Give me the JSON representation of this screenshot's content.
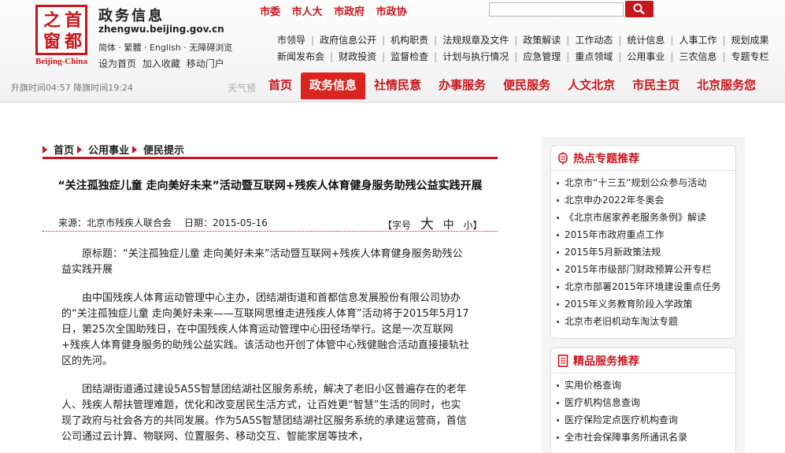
{
  "header": {
    "logo_chars": [
      "之",
      "首",
      "窗",
      "都"
    ],
    "logo_en": "Beijing-China",
    "site_title": "政务信息",
    "domain": "zhengwu.beijing.gov.cn",
    "lang_links": "简体 · 繁體 · English · 无障碍浏览",
    "util_links": [
      "设为首页",
      "加入收藏",
      "移动门户"
    ],
    "top_links": [
      "市委",
      "市人大",
      "市政府",
      "市政协"
    ],
    "search_placeholder": "",
    "sunrise_text": "升旗时间04:57 降旗时间19:24",
    "weather_text": "天气预"
  },
  "menu": {
    "row1": [
      "市领导",
      "政府信息公开",
      "机构职责",
      "法规规章及文件",
      "政策解读",
      "工作动态",
      "统计信息",
      "人事工作",
      "规划成果"
    ],
    "row2": [
      "新闻发布会",
      "财政投资",
      "监督检查",
      "计划与执行情况",
      "应急管理",
      "重点领域",
      "公用事业",
      "三农信息",
      "专题专栏"
    ]
  },
  "main_nav": [
    "首页",
    "政务信息",
    "社情民意",
    "办事服务",
    "便民服务",
    "人文北京",
    "市民主页",
    "北京服务您"
  ],
  "main_nav_active": 1,
  "breadcrumb": [
    "首页",
    "公用事业",
    "便民提示"
  ],
  "article": {
    "title": "“关注孤独症儿童 走向美好未来”活动暨互联网+残疾人体育健身服务助残公益实践开展",
    "source": "来源：北京市残疾人联合会",
    "date": "日期：2015-05-16",
    "font_label": "【字号",
    "font_large": "大",
    "font_medium": "中",
    "font_small": "小】",
    "paragraphs": [
      "原标题：“关注孤独症儿童 走向美好未来”活动暨互联网+残疾人体育健身服务助残公益实践开展",
      "由中国残疾人体育运动管理中心主办，团结湖街道和首都信息发展股份有限公司协办的“关注孤独症儿童 走向美好未来——互联网思维走进残疾人体育”活动将于2015年5月17日，第25次全国助残日，在中国残疾人体育运动管理中心田径场举行。这是一次互联网+残疾人体育健身服务的助残公益实践。该活动也开创了体管中心残健融合活动直接接轨社区的先河。",
      "团结湖街道通过建设5A5S智慧团结湖社区服务系统，解决了老旧小区普遍存在的老年人、残疾人帮扶管理难题，优化和改变居民生活方式，让百姓更“智慧”生活的同时，也实现了政府与社会各方的共同发展。作为5A5S智慧团结湖社区服务系统的承建运营商，首信公司通过云计算、物联网、位置服务、移动交互、智能家居等技术，"
    ]
  },
  "hot_topics": {
    "title": "热点专题推荐",
    "items": [
      "北京市“十三五”规划公众参与活动",
      "北京申办2022年冬奥会",
      "《北京市居家养老服务条例》解读",
      "2015年市政府重点工作",
      "2015年5月新政策法规",
      "2015年市级部门财政预算公开专栏",
      "北京市部署2015年环境建设重点任务",
      "2015年义务教育阶段入学政策",
      "北京市老旧机动车淘汰专题"
    ]
  },
  "services": {
    "title": "精品服务推荐",
    "items": [
      "实用价格查询",
      "医疗机构信息查询",
      "医疗保险定点医疗机构查询",
      "全市社会保障事务所通讯名录"
    ]
  },
  "colors": {
    "brand_red": "#c8161d",
    "nav_active": "#d9251d"
  }
}
